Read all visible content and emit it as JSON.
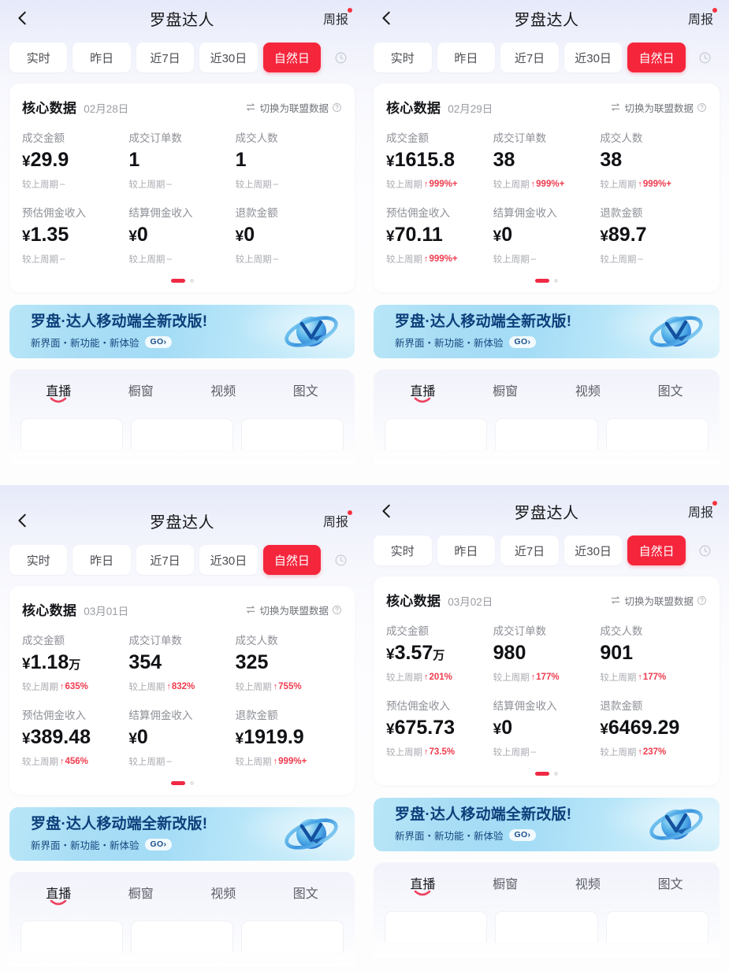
{
  "header": {
    "back_icon": "chevron-left-icon",
    "title": "罗盘达人",
    "weekly_label": "周报"
  },
  "filters": {
    "chips": [
      "实时",
      "昨日",
      "近7日",
      "近30日",
      "自然日"
    ],
    "active_index": 4,
    "more_icon": "clock-more-icon"
  },
  "card": {
    "title": "核心数据",
    "switch_label": "切换为联盟数据",
    "swap_icon": "swap-horizontal-icon",
    "help_icon": "question-circle-icon",
    "delta_prefix": "较上周期",
    "no_change": "–"
  },
  "banner": {
    "title": "罗盘·达人移动端全新改版!",
    "subtitle": "新界面・新功能・新体验",
    "cta": "GO›",
    "logo_icon": "compass-orbit-logo-icon"
  },
  "bottom_tabs": {
    "items": [
      "直播",
      "橱窗",
      "视频",
      "图文"
    ],
    "active_index": 0
  },
  "colors": {
    "accent_red": "#f5263c",
    "delta_up": "#ef3b4e",
    "banner_blue": "#0d3f7a",
    "text_primary": "#101114",
    "text_muted": "#8e9097"
  },
  "panels": [
    {
      "date": "02月28日",
      "metrics": [
        {
          "label": "成交金额",
          "yen": "¥",
          "value": "29.9",
          "unit": "",
          "delta": "–",
          "delta_up": false
        },
        {
          "label": "成交订单数",
          "yen": "",
          "value": "1",
          "unit": "",
          "delta": "–",
          "delta_up": false
        },
        {
          "label": "成交人数",
          "yen": "",
          "value": "1",
          "unit": "",
          "delta": "–",
          "delta_up": false
        },
        {
          "label": "预估佣金收入",
          "yen": "¥",
          "value": "1.35",
          "unit": "",
          "delta": "–",
          "delta_up": false
        },
        {
          "label": "结算佣金收入",
          "yen": "¥",
          "value": "0",
          "unit": "",
          "delta": "–",
          "delta_up": false
        },
        {
          "label": "退款金额",
          "yen": "¥",
          "value": "0",
          "unit": "",
          "delta": "–",
          "delta_up": false
        }
      ]
    },
    {
      "date": "02月29日",
      "metrics": [
        {
          "label": "成交金额",
          "yen": "¥",
          "value": "1615.8",
          "unit": "",
          "delta": "999%+",
          "delta_up": true
        },
        {
          "label": "成交订单数",
          "yen": "",
          "value": "38",
          "unit": "",
          "delta": "999%+",
          "delta_up": true
        },
        {
          "label": "成交人数",
          "yen": "",
          "value": "38",
          "unit": "",
          "delta": "999%+",
          "delta_up": true
        },
        {
          "label": "预估佣金收入",
          "yen": "¥",
          "value": "70.11",
          "unit": "",
          "delta": "999%+",
          "delta_up": true
        },
        {
          "label": "结算佣金收入",
          "yen": "¥",
          "value": "0",
          "unit": "",
          "delta": "–",
          "delta_up": false
        },
        {
          "label": "退款金额",
          "yen": "¥",
          "value": "89.7",
          "unit": "",
          "delta": "–",
          "delta_up": false
        }
      ]
    },
    {
      "date": "03月01日",
      "metrics": [
        {
          "label": "成交金额",
          "yen": "¥",
          "value": "1.18",
          "unit": "万",
          "delta": "635%",
          "delta_up": true
        },
        {
          "label": "成交订单数",
          "yen": "",
          "value": "354",
          "unit": "",
          "delta": "832%",
          "delta_up": true
        },
        {
          "label": "成交人数",
          "yen": "",
          "value": "325",
          "unit": "",
          "delta": "755%",
          "delta_up": true
        },
        {
          "label": "预估佣金收入",
          "yen": "¥",
          "value": "389.48",
          "unit": "",
          "delta": "456%",
          "delta_up": true
        },
        {
          "label": "结算佣金收入",
          "yen": "¥",
          "value": "0",
          "unit": "",
          "delta": "–",
          "delta_up": false
        },
        {
          "label": "退款金额",
          "yen": "¥",
          "value": "1919.9",
          "unit": "",
          "delta": "999%+",
          "delta_up": true
        }
      ]
    },
    {
      "date": "03月02日",
      "metrics": [
        {
          "label": "成交金额",
          "yen": "¥",
          "value": "3.57",
          "unit": "万",
          "delta": "201%",
          "delta_up": true
        },
        {
          "label": "成交订单数",
          "yen": "",
          "value": "980",
          "unit": "",
          "delta": "177%",
          "delta_up": true
        },
        {
          "label": "成交人数",
          "yen": "",
          "value": "901",
          "unit": "",
          "delta": "177%",
          "delta_up": true
        },
        {
          "label": "预估佣金收入",
          "yen": "¥",
          "value": "675.73",
          "unit": "",
          "delta": "73.5%",
          "delta_up": true
        },
        {
          "label": "结算佣金收入",
          "yen": "¥",
          "value": "0",
          "unit": "",
          "delta": "–",
          "delta_up": false
        },
        {
          "label": "退款金额",
          "yen": "¥",
          "value": "6469.29",
          "unit": "",
          "delta": "237%",
          "delta_up": true
        }
      ]
    }
  ]
}
